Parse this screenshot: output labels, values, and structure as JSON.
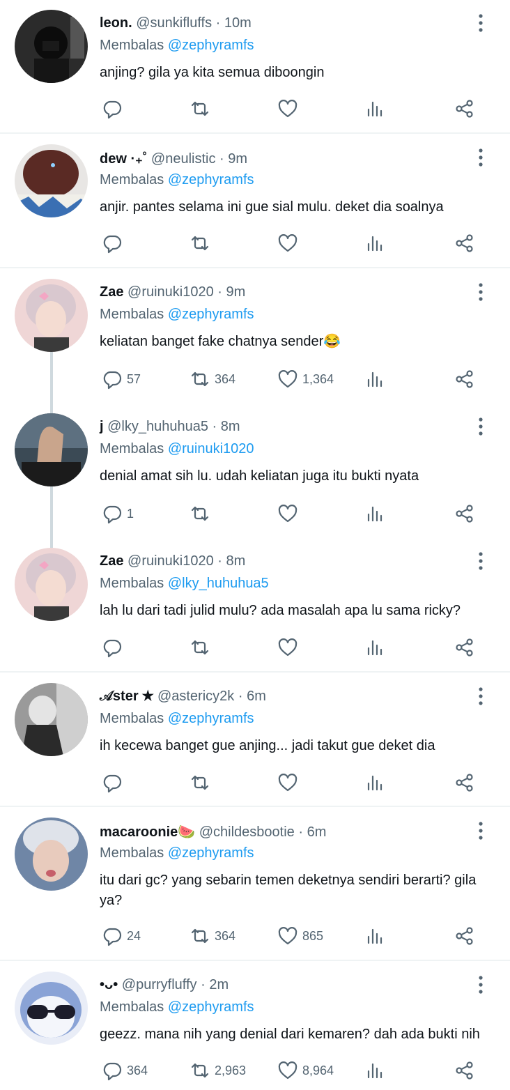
{
  "reply_prefix": "Membalas",
  "tweets": [
    {
      "name": "leon.",
      "handle": "@sunkifluffs",
      "time": "10m",
      "reply_to": "@zephyramfs",
      "text": "anjing? gila ya kita semua diboongin",
      "replies": "",
      "retweets": "",
      "likes": ""
    },
    {
      "name": "dew ·₊˚",
      "handle": "@neulistic",
      "time": "9m",
      "reply_to": "@zephyramfs",
      "text": "anjir. pantes selama ini gue sial mulu. deket dia soalnya",
      "replies": "",
      "retweets": "",
      "likes": ""
    },
    {
      "name": "Zae",
      "handle": "@ruinuki1020",
      "time": "9m",
      "reply_to": "@zephyramfs",
      "text": "keliatan banget fake chatnya sender😂",
      "replies": "57",
      "retweets": "364",
      "likes": "1,364"
    },
    {
      "name": "j",
      "handle": "@lky_huhuhua5",
      "time": "8m",
      "reply_to": "@ruinuki1020",
      "text": "denial amat sih lu. udah keliatan juga itu bukti nyata",
      "replies": "1",
      "retweets": "",
      "likes": ""
    },
    {
      "name": "Zae",
      "handle": "@ruinuki1020",
      "time": "8m",
      "reply_to": "@lky_huhuhua5",
      "text": "lah lu dari tadi julid mulu? ada masalah apa lu sama ricky?",
      "replies": "",
      "retweets": "",
      "likes": ""
    },
    {
      "name": "𝒜ster ★",
      "handle": "@astericy2k",
      "time": "6m",
      "reply_to": "@zephyramfs",
      "text": "ih kecewa banget gue anjing... jadi takut gue deket dia",
      "replies": "",
      "retweets": "",
      "likes": ""
    },
    {
      "name": "macaroonie🍉",
      "handle": "@childesbootie",
      "time": "6m",
      "reply_to": "@zephyramfs",
      "text": "itu dari gc? yang sebarin temen deketnya sendiri berarti? gila ya?",
      "replies": "24",
      "retweets": "364",
      "likes": "865"
    },
    {
      "name": "•ᴗ•",
      "handle": "@purryfluffy",
      "time": "2m",
      "reply_to": "@zephyramfs",
      "text": "geezz. mana nih yang denial dari kemaren? dah ada bukti nih",
      "replies": "364",
      "retweets": "2,963",
      "likes": "8,964"
    }
  ],
  "icons": {
    "reply": "reply-icon",
    "retweet": "retweet-icon",
    "like": "heart-icon",
    "views": "views-icon",
    "share": "share-icon",
    "more": "more-icon"
  },
  "colors": {
    "mention": "#1d9bf0",
    "secondary_text": "#536471",
    "thread_line": "#cfd9de"
  }
}
